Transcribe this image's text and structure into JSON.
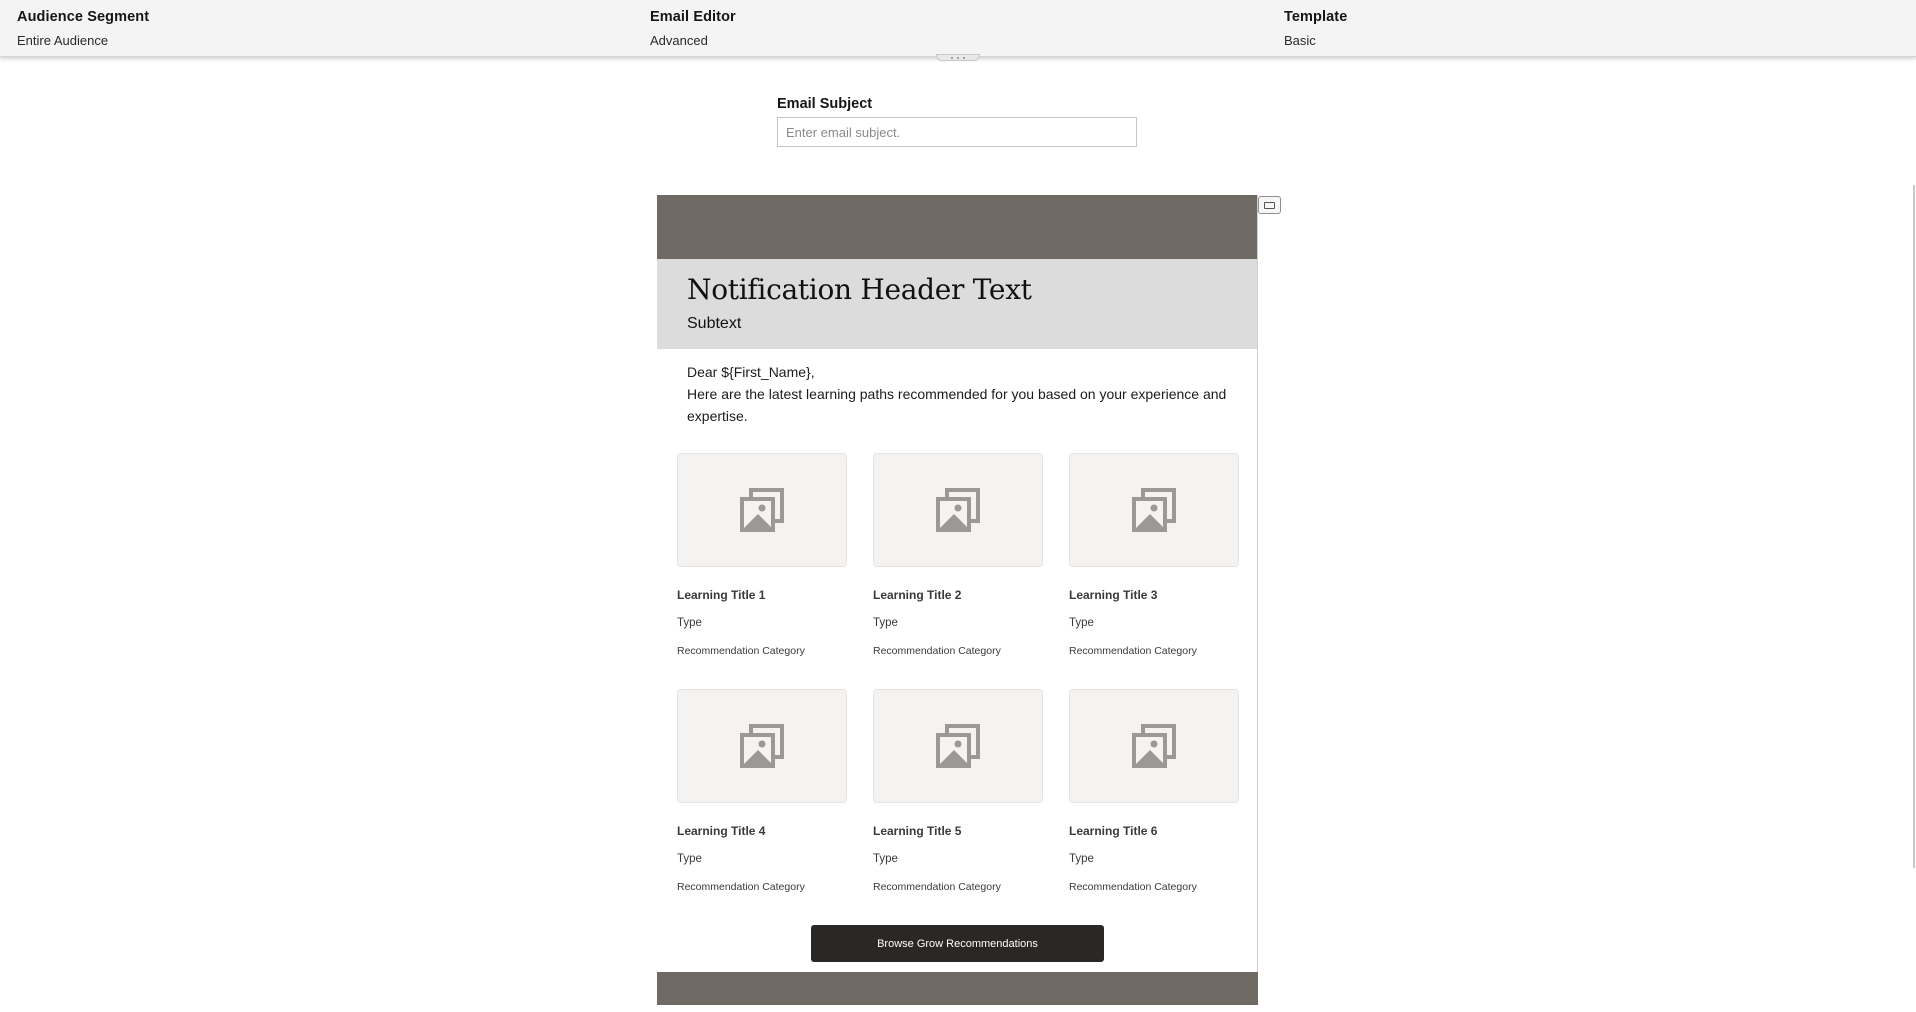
{
  "topbar": {
    "audience": {
      "label": "Audience Segment",
      "value": "Entire Audience"
    },
    "editor": {
      "label": "Email Editor",
      "value": "Advanced"
    },
    "template": {
      "label": "Template",
      "value": "Basic"
    }
  },
  "subject": {
    "label": "Email Subject",
    "placeholder": "Enter email subject.",
    "value": ""
  },
  "email": {
    "header_title": "Notification Header Text",
    "header_subtext": "Subtext",
    "greeting": "Dear ${First_Name},",
    "intro": "Here are the latest learning paths recommended for you based on your experience and expertise.",
    "cards": [
      {
        "title": "Learning Title 1",
        "type": "Type",
        "category": "Recommendation Category",
        "image_icon": "image-placeholder-icon"
      },
      {
        "title": "Learning Title 2",
        "type": "Type",
        "category": "Recommendation Category",
        "image_icon": "image-placeholder-icon"
      },
      {
        "title": "Learning Title 3",
        "type": "Type",
        "category": "Recommendation Category",
        "image_icon": "image-placeholder-icon"
      },
      {
        "title": "Learning Title 4",
        "type": "Type",
        "category": "Recommendation Category",
        "image_icon": "image-placeholder-icon"
      },
      {
        "title": "Learning Title 5",
        "type": "Type",
        "category": "Recommendation Category",
        "image_icon": "image-placeholder-icon"
      },
      {
        "title": "Learning Title 6",
        "type": "Type",
        "category": "Recommendation Category",
        "image_icon": "image-placeholder-icon"
      }
    ],
    "cta_label": "Browse Grow Recommendations"
  },
  "colors": {
    "email_band": "#6f6a64",
    "header_bg": "#dcdcdc",
    "thumb_bg": "#f4f3f1",
    "icon_gray": "#9b9895",
    "cta_bg": "#2a2725"
  }
}
